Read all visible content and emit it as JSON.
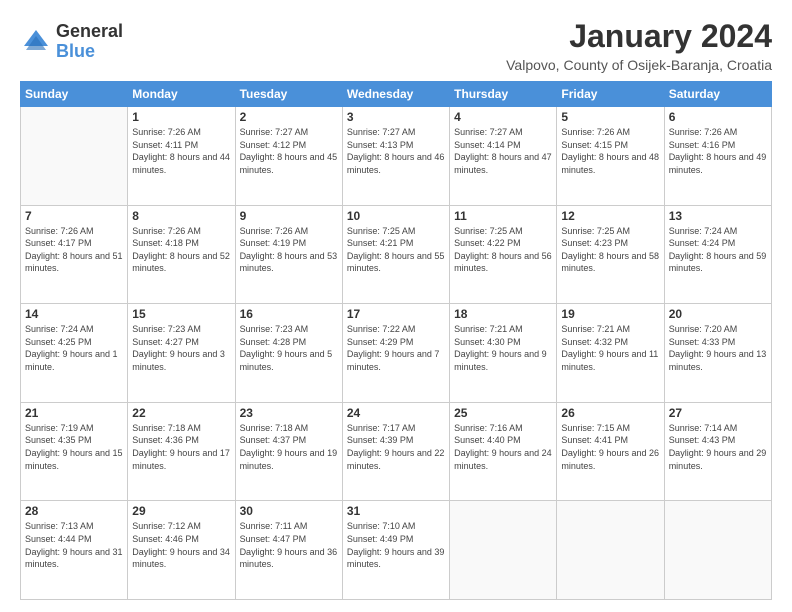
{
  "logo": {
    "general": "General",
    "blue": "Blue"
  },
  "header": {
    "month": "January 2024",
    "location": "Valpovo, County of Osijek-Baranja, Croatia"
  },
  "weekdays": [
    "Sunday",
    "Monday",
    "Tuesday",
    "Wednesday",
    "Thursday",
    "Friday",
    "Saturday"
  ],
  "weeks": [
    [
      {
        "day": "",
        "sunrise": "",
        "sunset": "",
        "daylight": ""
      },
      {
        "day": "1",
        "sunrise": "Sunrise: 7:26 AM",
        "sunset": "Sunset: 4:11 PM",
        "daylight": "Daylight: 8 hours and 44 minutes."
      },
      {
        "day": "2",
        "sunrise": "Sunrise: 7:27 AM",
        "sunset": "Sunset: 4:12 PM",
        "daylight": "Daylight: 8 hours and 45 minutes."
      },
      {
        "day": "3",
        "sunrise": "Sunrise: 7:27 AM",
        "sunset": "Sunset: 4:13 PM",
        "daylight": "Daylight: 8 hours and 46 minutes."
      },
      {
        "day": "4",
        "sunrise": "Sunrise: 7:27 AM",
        "sunset": "Sunset: 4:14 PM",
        "daylight": "Daylight: 8 hours and 47 minutes."
      },
      {
        "day": "5",
        "sunrise": "Sunrise: 7:26 AM",
        "sunset": "Sunset: 4:15 PM",
        "daylight": "Daylight: 8 hours and 48 minutes."
      },
      {
        "day": "6",
        "sunrise": "Sunrise: 7:26 AM",
        "sunset": "Sunset: 4:16 PM",
        "daylight": "Daylight: 8 hours and 49 minutes."
      }
    ],
    [
      {
        "day": "7",
        "sunrise": "Sunrise: 7:26 AM",
        "sunset": "Sunset: 4:17 PM",
        "daylight": "Daylight: 8 hours and 51 minutes."
      },
      {
        "day": "8",
        "sunrise": "Sunrise: 7:26 AM",
        "sunset": "Sunset: 4:18 PM",
        "daylight": "Daylight: 8 hours and 52 minutes."
      },
      {
        "day": "9",
        "sunrise": "Sunrise: 7:26 AM",
        "sunset": "Sunset: 4:19 PM",
        "daylight": "Daylight: 8 hours and 53 minutes."
      },
      {
        "day": "10",
        "sunrise": "Sunrise: 7:25 AM",
        "sunset": "Sunset: 4:21 PM",
        "daylight": "Daylight: 8 hours and 55 minutes."
      },
      {
        "day": "11",
        "sunrise": "Sunrise: 7:25 AM",
        "sunset": "Sunset: 4:22 PM",
        "daylight": "Daylight: 8 hours and 56 minutes."
      },
      {
        "day": "12",
        "sunrise": "Sunrise: 7:25 AM",
        "sunset": "Sunset: 4:23 PM",
        "daylight": "Daylight: 8 hours and 58 minutes."
      },
      {
        "day": "13",
        "sunrise": "Sunrise: 7:24 AM",
        "sunset": "Sunset: 4:24 PM",
        "daylight": "Daylight: 8 hours and 59 minutes."
      }
    ],
    [
      {
        "day": "14",
        "sunrise": "Sunrise: 7:24 AM",
        "sunset": "Sunset: 4:25 PM",
        "daylight": "Daylight: 9 hours and 1 minute."
      },
      {
        "day": "15",
        "sunrise": "Sunrise: 7:23 AM",
        "sunset": "Sunset: 4:27 PM",
        "daylight": "Daylight: 9 hours and 3 minutes."
      },
      {
        "day": "16",
        "sunrise": "Sunrise: 7:23 AM",
        "sunset": "Sunset: 4:28 PM",
        "daylight": "Daylight: 9 hours and 5 minutes."
      },
      {
        "day": "17",
        "sunrise": "Sunrise: 7:22 AM",
        "sunset": "Sunset: 4:29 PM",
        "daylight": "Daylight: 9 hours and 7 minutes."
      },
      {
        "day": "18",
        "sunrise": "Sunrise: 7:21 AM",
        "sunset": "Sunset: 4:30 PM",
        "daylight": "Daylight: 9 hours and 9 minutes."
      },
      {
        "day": "19",
        "sunrise": "Sunrise: 7:21 AM",
        "sunset": "Sunset: 4:32 PM",
        "daylight": "Daylight: 9 hours and 11 minutes."
      },
      {
        "day": "20",
        "sunrise": "Sunrise: 7:20 AM",
        "sunset": "Sunset: 4:33 PM",
        "daylight": "Daylight: 9 hours and 13 minutes."
      }
    ],
    [
      {
        "day": "21",
        "sunrise": "Sunrise: 7:19 AM",
        "sunset": "Sunset: 4:35 PM",
        "daylight": "Daylight: 9 hours and 15 minutes."
      },
      {
        "day": "22",
        "sunrise": "Sunrise: 7:18 AM",
        "sunset": "Sunset: 4:36 PM",
        "daylight": "Daylight: 9 hours and 17 minutes."
      },
      {
        "day": "23",
        "sunrise": "Sunrise: 7:18 AM",
        "sunset": "Sunset: 4:37 PM",
        "daylight": "Daylight: 9 hours and 19 minutes."
      },
      {
        "day": "24",
        "sunrise": "Sunrise: 7:17 AM",
        "sunset": "Sunset: 4:39 PM",
        "daylight": "Daylight: 9 hours and 22 minutes."
      },
      {
        "day": "25",
        "sunrise": "Sunrise: 7:16 AM",
        "sunset": "Sunset: 4:40 PM",
        "daylight": "Daylight: 9 hours and 24 minutes."
      },
      {
        "day": "26",
        "sunrise": "Sunrise: 7:15 AM",
        "sunset": "Sunset: 4:41 PM",
        "daylight": "Daylight: 9 hours and 26 minutes."
      },
      {
        "day": "27",
        "sunrise": "Sunrise: 7:14 AM",
        "sunset": "Sunset: 4:43 PM",
        "daylight": "Daylight: 9 hours and 29 minutes."
      }
    ],
    [
      {
        "day": "28",
        "sunrise": "Sunrise: 7:13 AM",
        "sunset": "Sunset: 4:44 PM",
        "daylight": "Daylight: 9 hours and 31 minutes."
      },
      {
        "day": "29",
        "sunrise": "Sunrise: 7:12 AM",
        "sunset": "Sunset: 4:46 PM",
        "daylight": "Daylight: 9 hours and 34 minutes."
      },
      {
        "day": "30",
        "sunrise": "Sunrise: 7:11 AM",
        "sunset": "Sunset: 4:47 PM",
        "daylight": "Daylight: 9 hours and 36 minutes."
      },
      {
        "day": "31",
        "sunrise": "Sunrise: 7:10 AM",
        "sunset": "Sunset: 4:49 PM",
        "daylight": "Daylight: 9 hours and 39 minutes."
      },
      {
        "day": "",
        "sunrise": "",
        "sunset": "",
        "daylight": ""
      },
      {
        "day": "",
        "sunrise": "",
        "sunset": "",
        "daylight": ""
      },
      {
        "day": "",
        "sunrise": "",
        "sunset": "",
        "daylight": ""
      }
    ]
  ]
}
